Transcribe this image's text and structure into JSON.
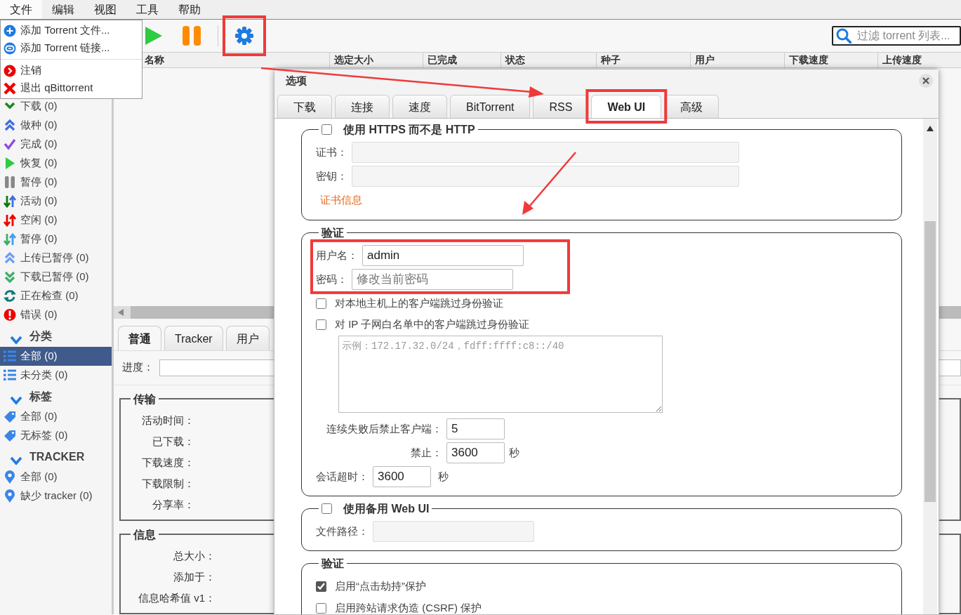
{
  "menubar": [
    {
      "label": "文件",
      "selected": true
    },
    {
      "label": "编辑",
      "selected": false
    },
    {
      "label": "视图",
      "selected": false
    },
    {
      "label": "工具",
      "selected": false
    },
    {
      "label": "帮助",
      "selected": false
    }
  ],
  "file_menu": {
    "groups": [
      [
        {
          "kind": "add-file",
          "label": "添加 Torrent 文件..."
        },
        {
          "kind": "add-link",
          "label": "添加 Torrent 链接..."
        }
      ],
      [
        {
          "kind": "logout",
          "label": "注销"
        },
        {
          "kind": "exit",
          "label": "退出 qBittorrent"
        }
      ]
    ]
  },
  "search": {
    "placeholder": "过滤 torrent 列表..."
  },
  "sidebar": {
    "status": [
      {
        "kind": "downloading",
        "label": "下载 (0)",
        "selected": false
      },
      {
        "kind": "seeding",
        "label": "做种 (0)",
        "selected": false
      },
      {
        "kind": "completed",
        "label": "完成 (0)",
        "selected": false
      },
      {
        "kind": "resumed",
        "label": "恢复 (0)",
        "selected": false
      },
      {
        "kind": "paused",
        "label": "暂停 (0)",
        "selected": false
      },
      {
        "kind": "active",
        "label": "活动 (0)",
        "selected": false
      },
      {
        "kind": "inactive",
        "label": "空闲 (0)",
        "selected": false
      },
      {
        "kind": "stalled",
        "label": "暂停 (0)",
        "selected": false
      },
      {
        "kind": "stalled-up",
        "label": "上传已暂停 (0)",
        "selected": false
      },
      {
        "kind": "stalled-down",
        "label": "下载已暂停 (0)",
        "selected": false
      },
      {
        "kind": "checking",
        "label": "正在检查 (0)",
        "selected": false
      },
      {
        "kind": "errored",
        "label": "错误 (0)",
        "selected": false
      }
    ],
    "sections": [
      {
        "kind": "category",
        "title": "分类",
        "expanded": true,
        "items": [
          {
            "label": "全部 (0)",
            "selected": true
          },
          {
            "label": "未分类 (0)",
            "selected": false
          }
        ]
      },
      {
        "kind": "tag",
        "title": "标签",
        "expanded": true,
        "items": [
          {
            "label": "全部 (0)",
            "selected": false
          },
          {
            "label": "无标签 (0)",
            "selected": false
          }
        ]
      },
      {
        "kind": "tracker",
        "title": "TRACKER",
        "expanded": true,
        "items": [
          {
            "label": "全部 (0)",
            "selected": false
          },
          {
            "label": "缺少 tracker (0)",
            "selected": false
          }
        ]
      }
    ]
  },
  "table": {
    "columns": [
      "名称",
      "选定大小",
      "已完成",
      "状态",
      "种子",
      "用户",
      "下载速度",
      "上传速度"
    ]
  },
  "details": {
    "tabs": [
      {
        "label": "普通",
        "selected": true
      },
      {
        "label": "Tracker",
        "selected": false
      },
      {
        "label": "用户",
        "selected": false
      }
    ],
    "progress": {
      "label": "进度：",
      "level": 0
    },
    "groups": [
      {
        "title": "传输",
        "fields": [
          "活动时间：",
          "已下载：",
          "下载速度：",
          "下载限制：",
          "分享率："
        ]
      },
      {
        "title": "信息",
        "fields": [
          "总大小：",
          "添加于：",
          "信息哈希值 v1："
        ]
      }
    ]
  },
  "dialog": {
    "title": "选项",
    "tabs": [
      {
        "label": "下载",
        "selected": false
      },
      {
        "label": "连接",
        "selected": false
      },
      {
        "label": "速度",
        "selected": false
      },
      {
        "label": "BitTorrent",
        "selected": false
      },
      {
        "label": "RSS",
        "selected": false
      },
      {
        "label": "Web UI",
        "selected": true
      },
      {
        "label": "高级",
        "selected": false
      }
    ],
    "sections": [
      {
        "legend": "使用 HTTPS 而不是 HTTP",
        "checked": false,
        "rows": [
          {
            "kind": "path",
            "label": "证书：",
            "disabled": true
          },
          {
            "kind": "path",
            "label": "密钥：",
            "disabled": true
          },
          {
            "kind": "link",
            "text": "证书信息"
          }
        ]
      },
      {
        "legend": "验证",
        "rows": [
          {
            "kind": "text",
            "label": "用户名：",
            "value": "admin",
            "disabled": false
          },
          {
            "kind": "text",
            "label": "密码：",
            "placeholder": "修改当前密码",
            "disabled": false
          },
          {
            "kind": "check",
            "label": "对本地主机上的客户端跳过身份验证",
            "checked": false
          },
          {
            "kind": "check",
            "label": "对 IP 子网白名单中的客户端跳过身份验证",
            "checked": false
          },
          {
            "kind": "textarea",
            "placeholder": "示例：172.17.32.0/24，fdff:ffff:c8::/40"
          },
          {
            "kind": "number",
            "label": "连续失败后禁止客户端：",
            "value": "5",
            "disabled": false
          },
          {
            "kind": "number",
            "label": "禁止：",
            "value": "3600",
            "unit": "秒",
            "disabled": false
          },
          {
            "kind": "inline",
            "label": "会话超时：",
            "value": "3600",
            "unit": "秒",
            "disabled": false
          }
        ]
      },
      {
        "legend": "使用备用 Web UI",
        "checked": false,
        "rows": [
          {
            "kind": "text",
            "label": "文件路径：",
            "disabled": true
          }
        ]
      },
      {
        "legend": "验证",
        "rows": [
          {
            "kind": "check",
            "label": "启用“点击劫持”保护",
            "checked": true
          },
          {
            "kind": "check",
            "label": "启用跨站请求伪造 (CSRF) 保护",
            "checked": false
          }
        ]
      }
    ]
  }
}
